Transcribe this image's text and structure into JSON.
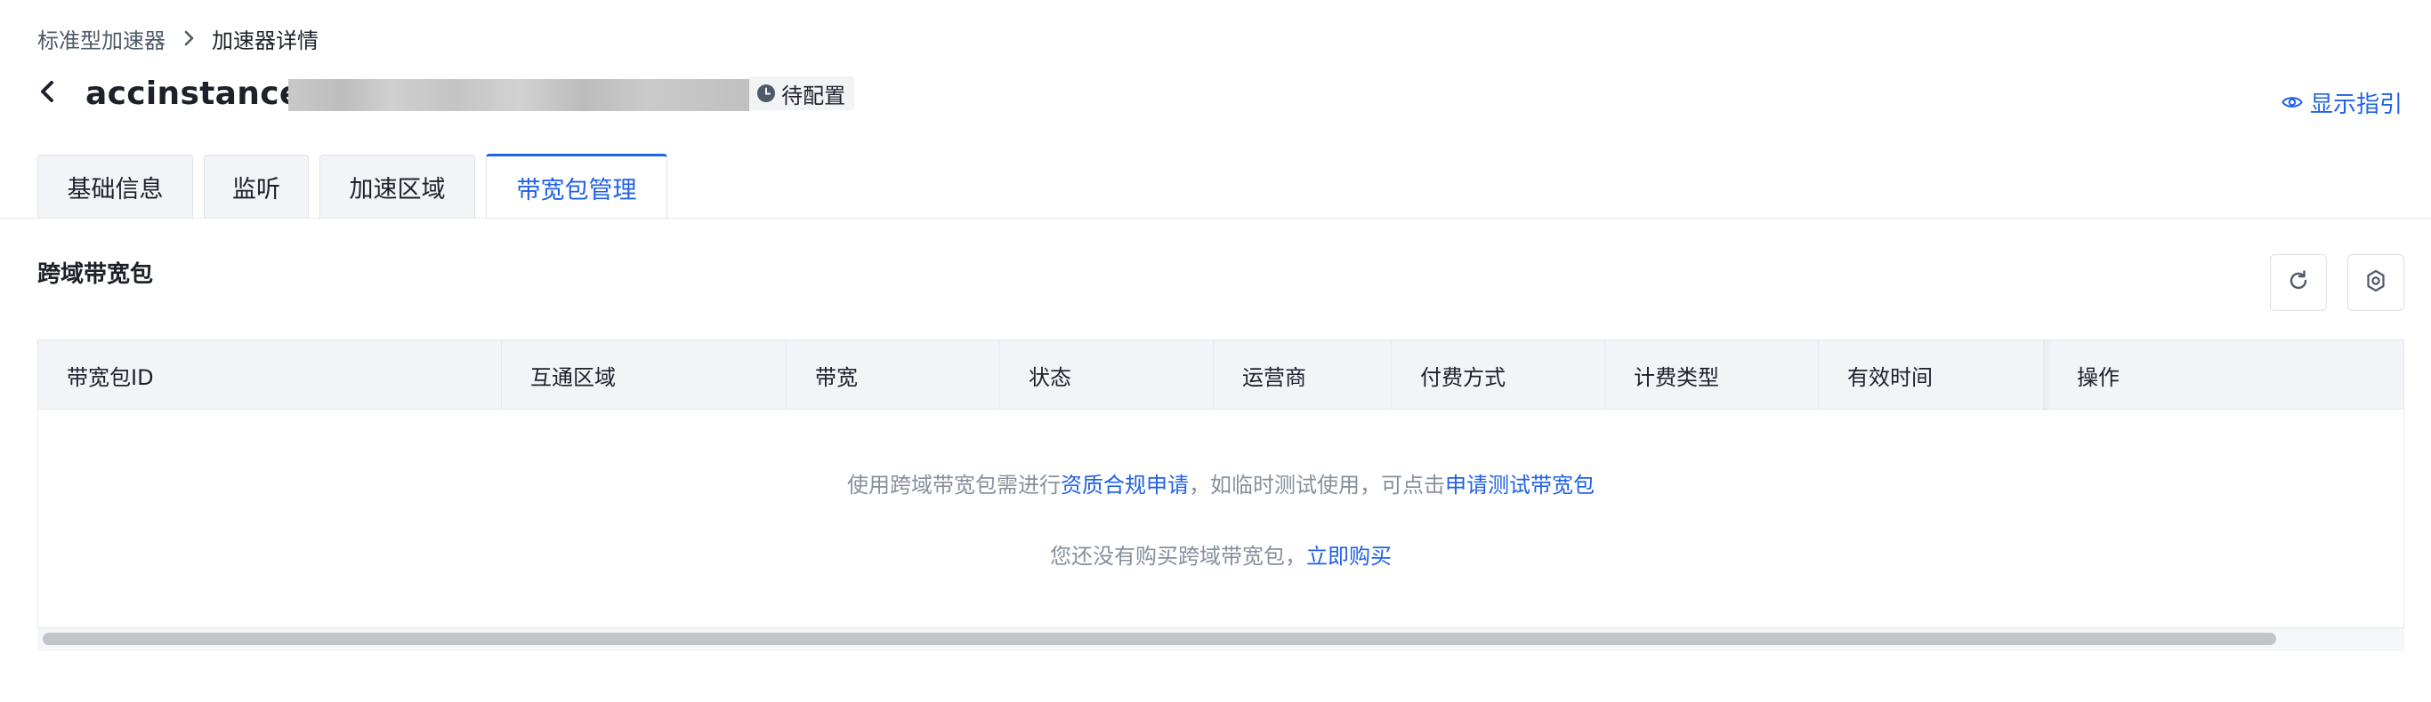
{
  "breadcrumb": {
    "parent": "标准型加速器",
    "current": "加速器详情"
  },
  "header": {
    "title": "accinstance-o                              4F",
    "status": "待配置",
    "guide_link": "显示指引"
  },
  "tabs": [
    {
      "label": "基础信息",
      "active": false
    },
    {
      "label": "监听",
      "active": false
    },
    {
      "label": "加速区域",
      "active": false
    },
    {
      "label": "带宽包管理",
      "active": true
    }
  ],
  "section": {
    "title": "跨域带宽包"
  },
  "table": {
    "columns": [
      "带宽包ID",
      "互通区域",
      "带宽",
      "状态",
      "运营商",
      "付费方式",
      "计费类型",
      "有效时间",
      "操作"
    ],
    "rows": []
  },
  "empty_state": {
    "line1_prefix": "使用跨域带宽包需进行",
    "line1_link1": "资质合规申请",
    "line1_middle": "，如临时测试使用，可点击",
    "line1_link2": "申请测试带宽包",
    "line2_prefix": "您还没有购买跨域带宽包，",
    "line2_link": "立即购买"
  },
  "icons": {
    "back": "chevron-left-icon",
    "breadcrumb_sep": "chevron-right-icon",
    "status": "clock-icon",
    "guide": "eye-icon",
    "refresh": "refresh-icon",
    "settings": "gear-icon"
  },
  "colors": {
    "accent": "#2061e6",
    "muted_text": "#86909c",
    "header_bg": "#f2f4f8"
  }
}
